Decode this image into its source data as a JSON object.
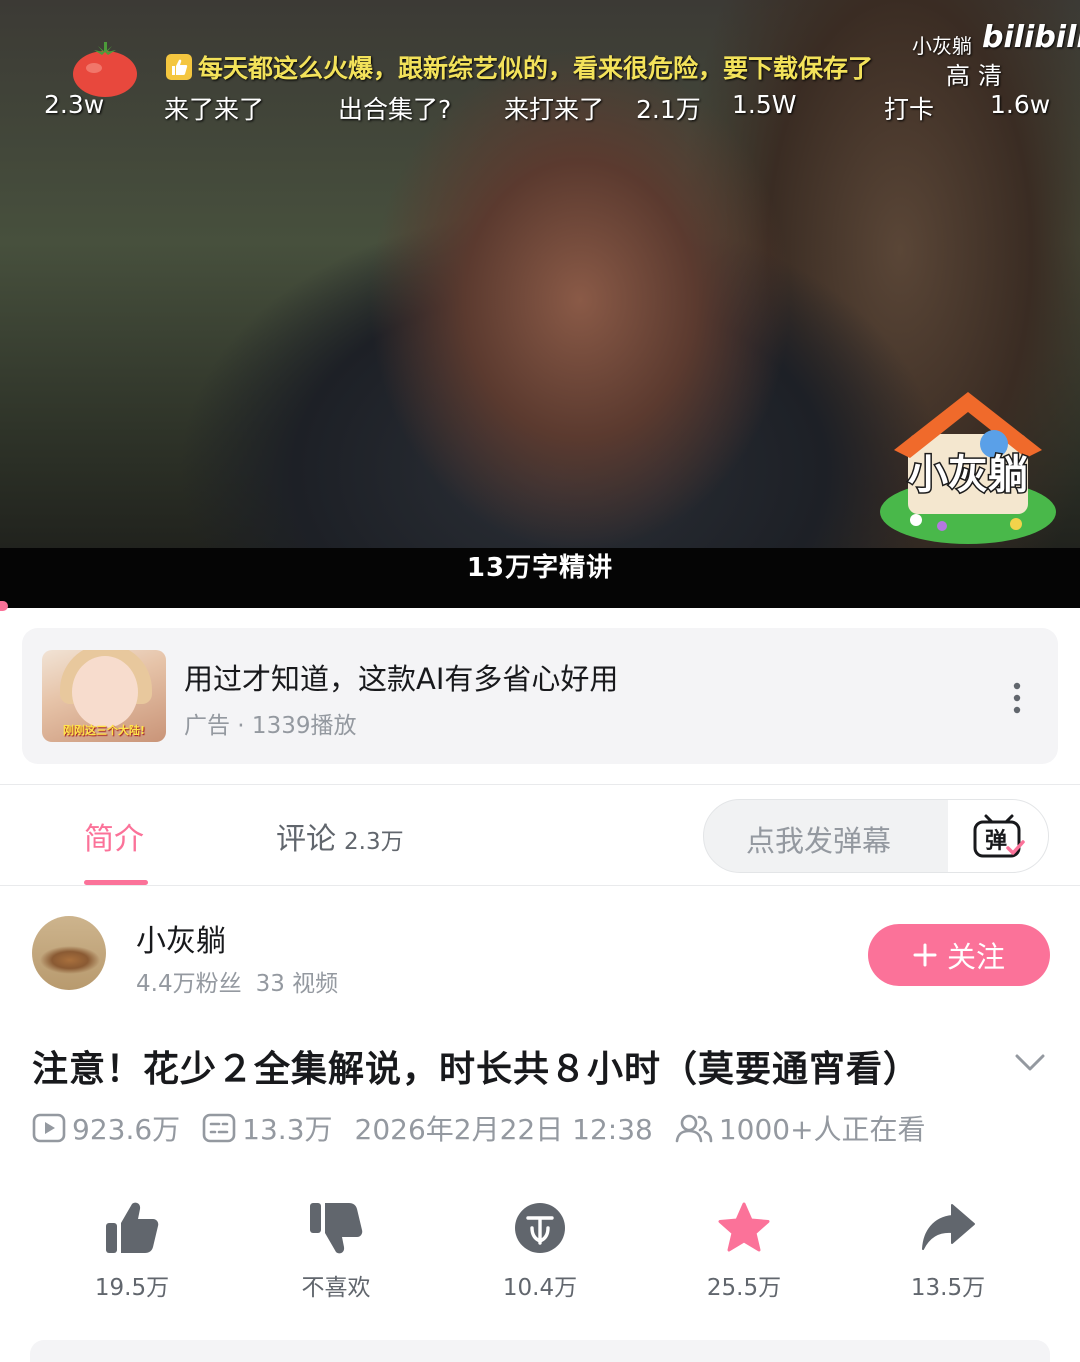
{
  "player": {
    "subtitle": "13万字精讲",
    "top_danmaku": "每天都这么火爆，跟新综艺似的，看来很危险，要下载保存了",
    "danmaku": [
      "2.3w",
      "来了来了",
      "出合集了?",
      "来打来了",
      "2.1万",
      "1.5W",
      "打卡",
      "1.6w"
    ],
    "watermark_user": "小灰躺",
    "watermark_logo": "bilibili",
    "quality": "高清",
    "corner_logo_text": "小灰躺"
  },
  "ad": {
    "title": "用过才知道，这款AI有多省心好用",
    "meta": "广告 · 1339播放",
    "thumb_caption": "刚刚这三个大陆!"
  },
  "tabs": {
    "intro": "简介",
    "comments": "评论",
    "comments_count": "2.3万"
  },
  "danmaku_input": {
    "placeholder": "点我发弹幕",
    "button_glyph": "弹"
  },
  "uploader": {
    "name": "小灰躺",
    "fans": "4.4万粉丝",
    "videos": "33 视频",
    "follow_label": "关注"
  },
  "video": {
    "title": "注意！花少２全集解说，时长共８小时（莫要通宵看）",
    "plays": "923.6万",
    "danmaku_count": "13.3万",
    "date": "2026年2月22日 12:38",
    "watching": "1000+人正在看"
  },
  "actions": {
    "like": "19.5万",
    "dislike": "不喜欢",
    "coin": "10.4万",
    "favorite": "25.5万",
    "share": "13.5万"
  },
  "colors": {
    "brand_pink": "#fb7299",
    "text_primary": "#18191c",
    "text_secondary": "#9499a0",
    "icon_gray": "#61666d"
  }
}
